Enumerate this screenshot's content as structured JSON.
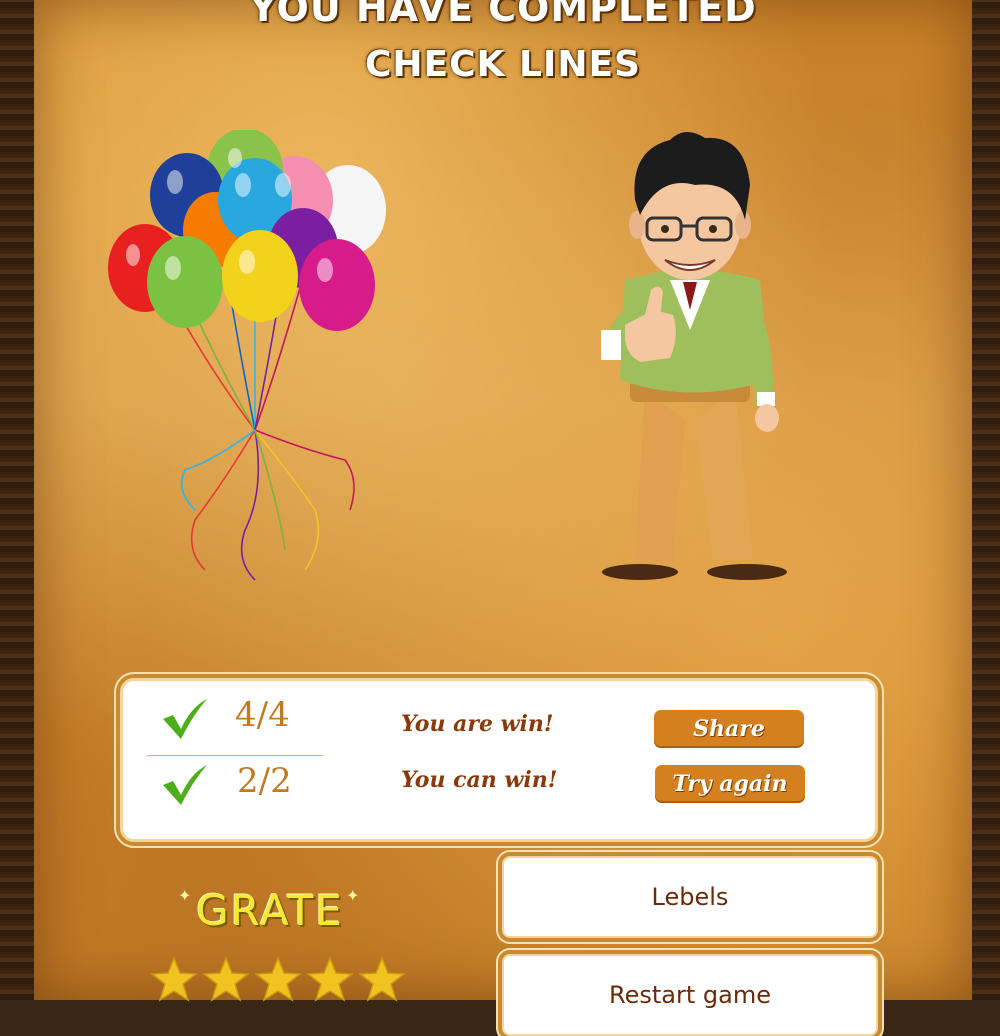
{
  "title": {
    "line1": "YOU HAVE COMPLETED",
    "line2": "CHECK LINES"
  },
  "results": {
    "rows": [
      {
        "icon": "checkmark-icon",
        "score": "4/4",
        "message": "You are win!",
        "action": "Share"
      },
      {
        "icon": "checkmark-icon",
        "score": "2/2",
        "message": "You can win!",
        "action": "Try again"
      }
    ]
  },
  "menu": {
    "levels": "Lebels",
    "restart": "Restart game"
  },
  "rating": {
    "label": "GRATE",
    "stars_filled": 5,
    "stars_total": 5
  },
  "illustrations": {
    "left": "balloons-bunch",
    "right": "thumbs-up-man"
  },
  "colors": {
    "accent": "#d4801e",
    "message": "#8a3a0a",
    "score": "#c27a22",
    "check": "#4caf1a",
    "grade": "#f6e832"
  }
}
